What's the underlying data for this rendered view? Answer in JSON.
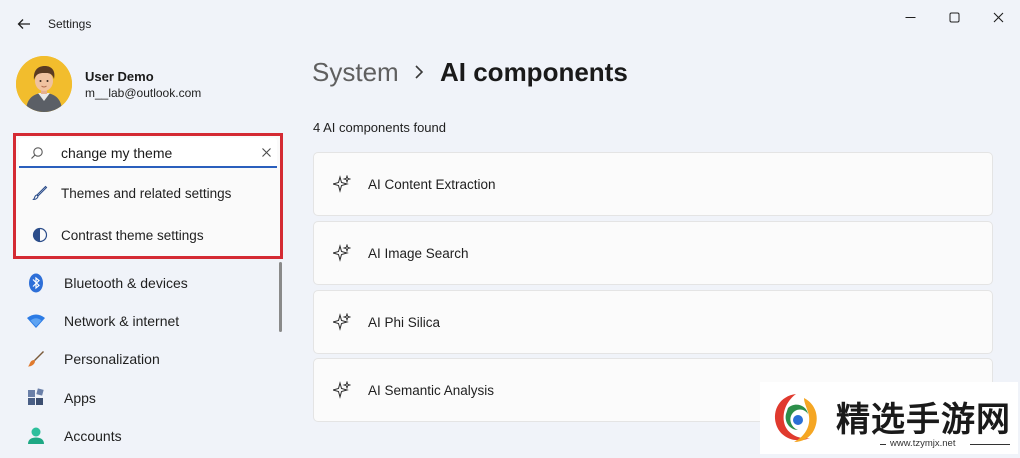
{
  "window": {
    "title": "Settings"
  },
  "profile": {
    "name": "User Demo",
    "email": "m__lab@outlook.com"
  },
  "search": {
    "value": "change my theme",
    "suggestions": [
      {
        "label": "Themes and related settings",
        "icon": "brush-icon"
      },
      {
        "label": "Contrast theme settings",
        "icon": "contrast-icon"
      }
    ]
  },
  "nav": {
    "items": [
      {
        "label": "Bluetooth & devices",
        "icon": "bluetooth-icon"
      },
      {
        "label": "Network & internet",
        "icon": "wifi-icon"
      },
      {
        "label": "Personalization",
        "icon": "paintbrush-icon"
      },
      {
        "label": "Apps",
        "icon": "apps-icon"
      },
      {
        "label": "Accounts",
        "icon": "accounts-icon"
      }
    ]
  },
  "main": {
    "breadcrumb_parent": "System",
    "breadcrumb_current": "AI components",
    "found_text": "4 AI components found",
    "components": [
      {
        "label": "AI Content Extraction",
        "icon": "sparkle-icon"
      },
      {
        "label": "AI Image Search",
        "icon": "sparkle-icon"
      },
      {
        "label": "AI Phi Silica",
        "icon": "sparkle-icon"
      },
      {
        "label": "AI Semantic Analysis",
        "icon": "sparkle-icon"
      }
    ]
  },
  "watermark": {
    "text": "精选手游网",
    "url": "www.tzymjx.net"
  },
  "colors": {
    "highlight_border": "#d42a33",
    "accent": "#2a5fbd",
    "background": "#f0f3f9"
  }
}
